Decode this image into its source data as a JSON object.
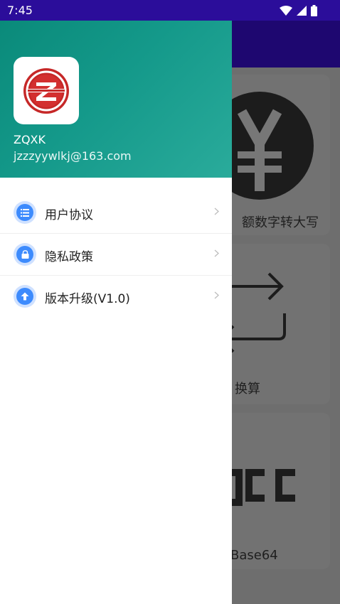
{
  "status_bar": {
    "time": "7:45",
    "icons": [
      "wifi-icon",
      "signal-icon",
      "battery-icon"
    ]
  },
  "colors": {
    "status_bar": "#2b0d9a",
    "drawer_header_start": "#0a8a7a",
    "drawer_header_end": "#2aab9b",
    "menu_icon_accent": "#3d8bfd"
  },
  "background_app": {
    "cards": [
      {
        "icon": "yen-icon",
        "label": "额数字转大写"
      },
      {
        "icon": "swap-arrows-icon",
        "label": "换算"
      },
      {
        "icon": "abc-icon",
        "label": "Base64"
      }
    ]
  },
  "drawer": {
    "header": {
      "logo": "zqxk-logo",
      "app_name": "ZQXK",
      "email": "jzzzyywlkj@163.com"
    },
    "menu": [
      {
        "icon": "list-icon",
        "label": "用户协议"
      },
      {
        "icon": "lock-icon",
        "label": "隐私政策"
      },
      {
        "icon": "upgrade-arrow-icon",
        "label": "版本升级(V1.0)"
      }
    ]
  }
}
